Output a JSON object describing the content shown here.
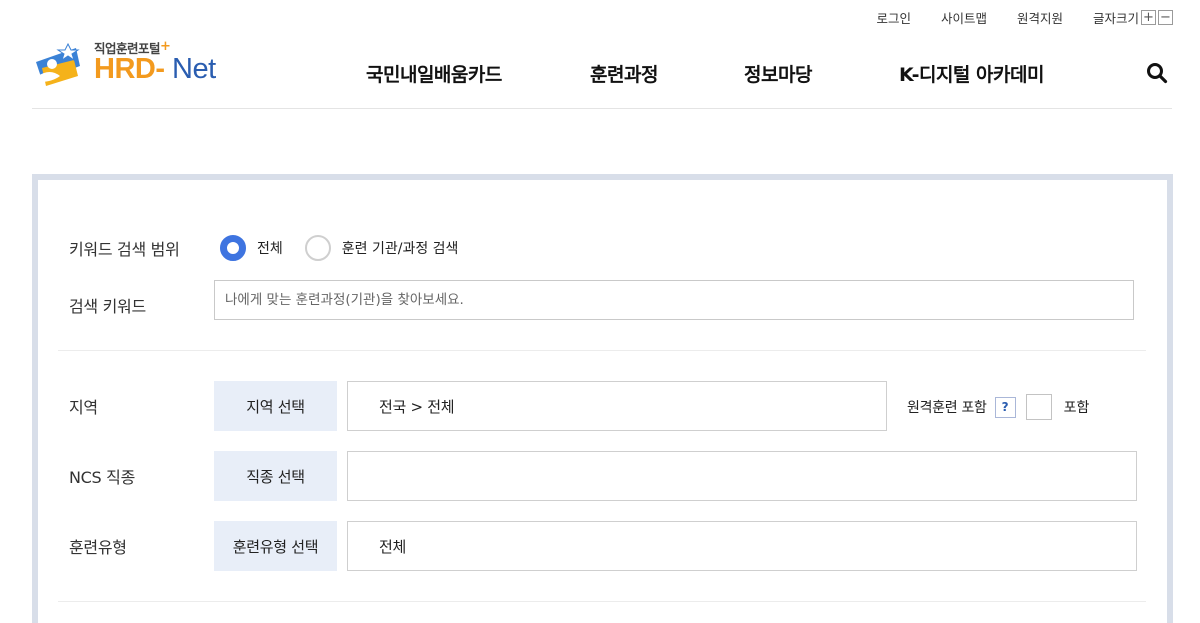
{
  "utility": {
    "login": "로그인",
    "sitemap": "사이트맵",
    "remote_support": "원격지원",
    "font_size": "글자크기",
    "plus": "+",
    "minus": "−"
  },
  "logo": {
    "tagline": "직업훈련포털",
    "tagline_plus": "+",
    "brand_a": "HRD-",
    "brand_b": " Net"
  },
  "gnb": [
    "국민내일배움카드",
    "훈련과정",
    "정보마당",
    "K-디지털 아카데미"
  ],
  "search_form": {
    "keyword_scope": {
      "label": "키워드 검색 범위",
      "options": [
        {
          "label": "전체",
          "selected": true
        },
        {
          "label": "훈련 기관/과정 검색",
          "selected": false
        }
      ]
    },
    "keyword": {
      "label": "검색 키워드",
      "value": "",
      "placeholder": "나에게 맞는 훈련과정(기관)을 찾아보세요."
    },
    "region": {
      "label": "지역",
      "button": "지역 선택",
      "value": "전국 > 전체"
    },
    "remote": {
      "label": "원격훈련 포함",
      "help": "?",
      "checkbox_label": "포함",
      "checked": false
    },
    "ncs": {
      "label": "NCS 직종",
      "button": "직종 선택",
      "value": ""
    },
    "training_type": {
      "label": "훈련유형",
      "button": "훈련유형 선택",
      "value": "전체"
    }
  },
  "colors": {
    "accent_blue": "#3e74e0",
    "brand_orange": "#f39a1e",
    "brand_blue": "#2a5db0",
    "panel_border": "#d8dee9",
    "select_button_bg": "#e8eef8"
  }
}
